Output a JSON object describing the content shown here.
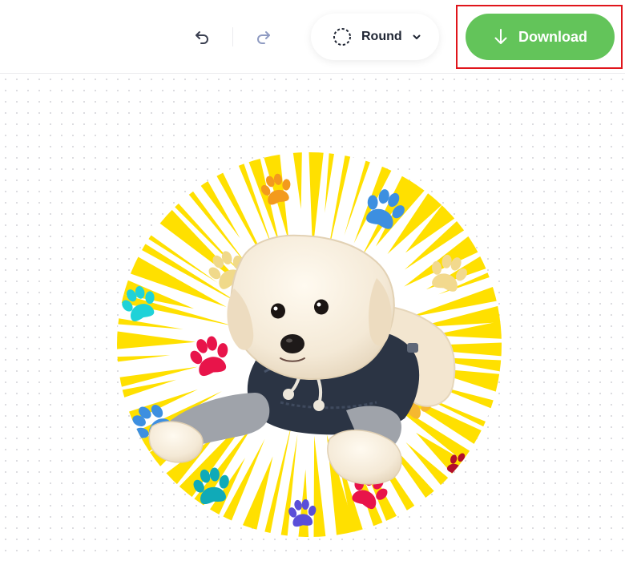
{
  "toolbar": {
    "undo_icon": "undo-icon",
    "redo_icon": "redo-icon",
    "shape_icon": "dashed-circle-icon",
    "shape_label": "Round",
    "shape_chevron_icon": "chevron-down-icon",
    "download_icon": "arrow-down-icon",
    "download_label": "Download"
  },
  "canvas": {
    "image_subject": "dog-photo",
    "shape": "circle"
  },
  "colors": {
    "download_button": "#63c45a",
    "highlight_border": "#e0151b",
    "burst_yellow": "#ffe000",
    "text_dark": "#1f2533",
    "icon_undo": "#3a3f50",
    "icon_redo": "#8f9bc2"
  }
}
